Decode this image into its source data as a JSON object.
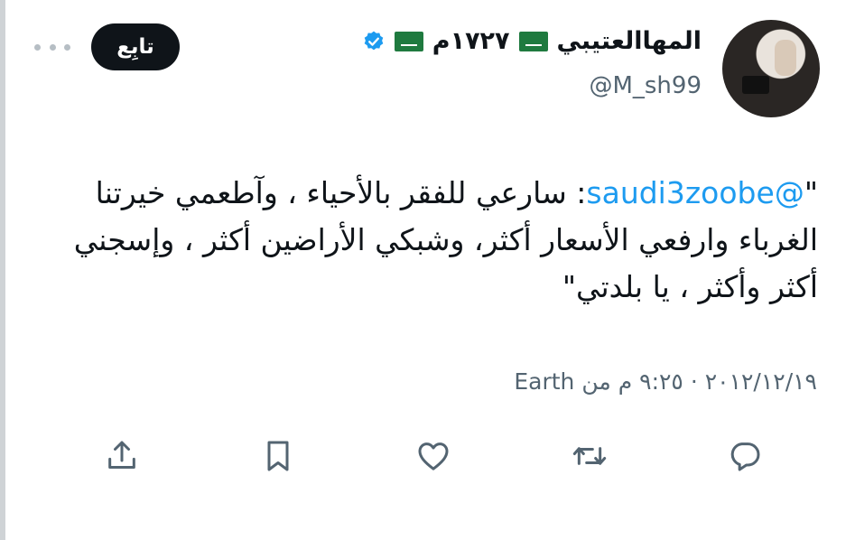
{
  "user": {
    "display_name": "المهاالعتيبي",
    "suffix": "١٧٢٧م",
    "handle": "@M_sh99"
  },
  "follow_button": "تابِع",
  "tweet": {
    "quote_open": "\"",
    "mention": "@saudi3zoobe",
    "body": ": سارعي للفقر بالأحياء ، وآطعمي خيرتنا الغرباء وارفعي الأسعار أكثر، وشبكي الأراضين أكثر ، وإسجني أكثر وأكثر ، يا بلدتي\""
  },
  "meta": "٢٠١٢/١٢/١٩ · ٩:٢٥ م من Earth",
  "colors": {
    "mention": "#1d9bf0",
    "verified": "#1d9bf0",
    "flag": "#1f7a3f"
  },
  "icons": [
    "reply-icon",
    "retweet-icon",
    "like-icon",
    "bookmark-icon",
    "share-icon"
  ]
}
